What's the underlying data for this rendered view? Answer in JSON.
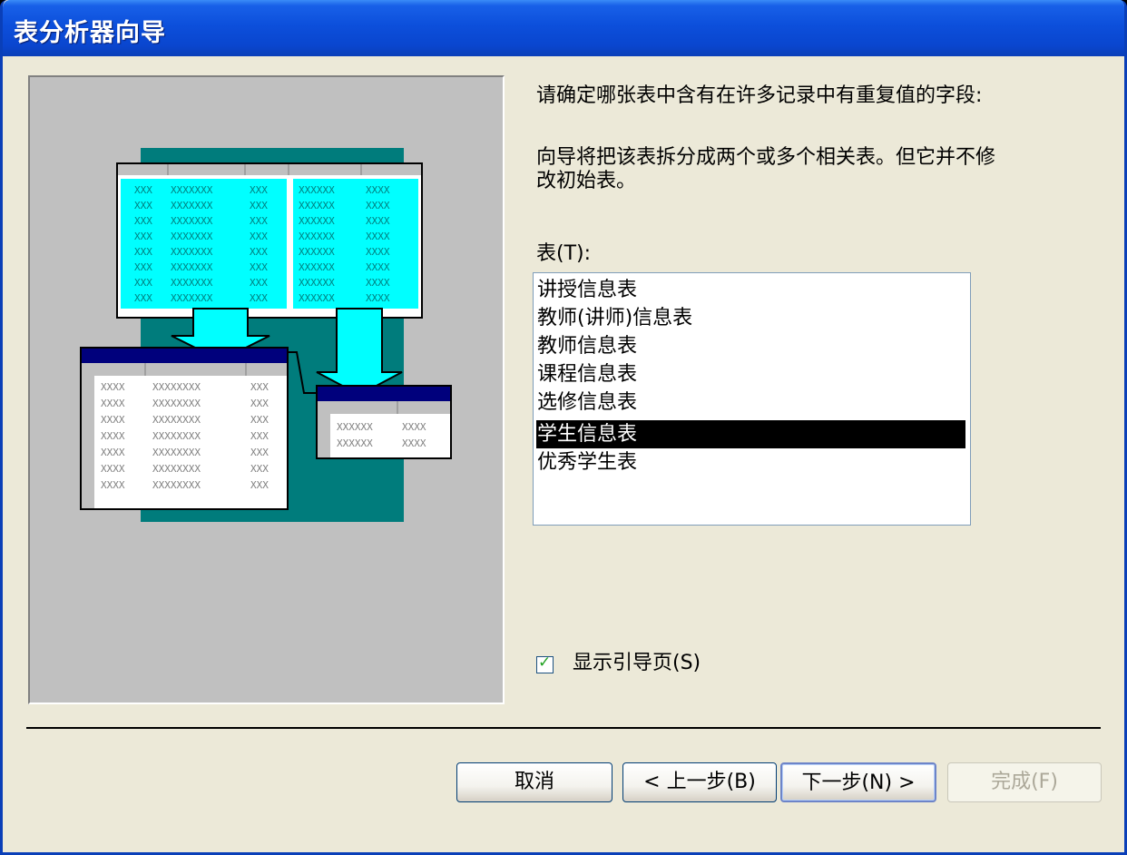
{
  "window": {
    "title": "表分析器向导"
  },
  "instructions": {
    "line1": "请确定哪张表中含有在许多记录中有重复值的字段:",
    "line2a": "向导将把该表拆分成两个或多个相关表。但它并不修",
    "line2b": "改初始表。"
  },
  "tables_label": "表(T):",
  "tables": {
    "items": [
      "讲授信息表",
      "教师(讲师)信息表",
      "教师信息表",
      "课程信息表",
      "选修信息表",
      "学生信息表",
      "优秀学生表"
    ],
    "selected_index": 5
  },
  "illustration": {
    "cell_short": "XXX",
    "cell_mid": "XXXX",
    "cell_long": "XXXXXXX",
    "cell_long2": "XXXXXXXX",
    "cell_six": "XXXXXX"
  },
  "show_intro_checkbox": {
    "label": "显示引导页(S)",
    "checked": true
  },
  "buttons": {
    "cancel": "取消",
    "back": "< 上一步(B)",
    "next": "下一步(N) >",
    "finish": "完成(F)",
    "finish_enabled": false
  },
  "colors": {
    "title_bar": "#0a46cf",
    "dialog_bg": "#ece9d8",
    "illus_teal": "#007c7c",
    "illus_cyan": "#00ffff",
    "illus_navy": "#00007c"
  }
}
